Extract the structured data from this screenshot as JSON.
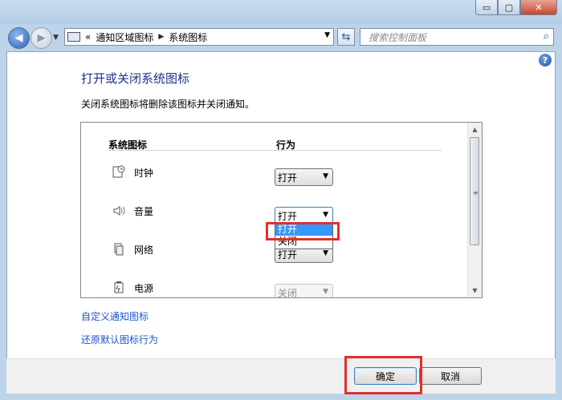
{
  "window": {
    "min_glyph": "▭",
    "max_glyph": "▢",
    "close_glyph": "✕"
  },
  "navbar": {
    "back_glyph": "◀",
    "forward_glyph": "▶",
    "address_prefix": "«",
    "breadcrumb": [
      "通知区域图标",
      "系统图标"
    ],
    "breadcrumb_sep": "▶",
    "dropdown_glyph": "▼",
    "search_placeholder": "搜索控制面板"
  },
  "main": {
    "title": "打开或关闭系统图标",
    "description": "关闭系统图标将删除该图标并关闭通知。",
    "columns": {
      "icon": "系统图标",
      "behavior": "行为"
    },
    "rows": [
      {
        "label": "时钟",
        "icon": "clock-icon",
        "value": "打开",
        "state": "normal"
      },
      {
        "label": "音量",
        "icon": "volume-icon",
        "value": "打开",
        "state": "open"
      },
      {
        "label": "网络",
        "icon": "network-icon",
        "value": "打开",
        "state": "normal"
      },
      {
        "label": "电源",
        "icon": "power-icon",
        "value": "关闭",
        "state": "disabled"
      }
    ],
    "dropdown_options": [
      {
        "label": "打开",
        "selected": true
      },
      {
        "label": "关闭",
        "selected": false
      }
    ],
    "links": [
      "自定义通知图标",
      "还原默认图标行为"
    ]
  },
  "footer": {
    "ok": "确定",
    "cancel": "取消"
  },
  "colors": {
    "title": "#1e3287",
    "link": "#1f55c8",
    "highlight": "#e02f2f",
    "selection": "#3399ff"
  }
}
